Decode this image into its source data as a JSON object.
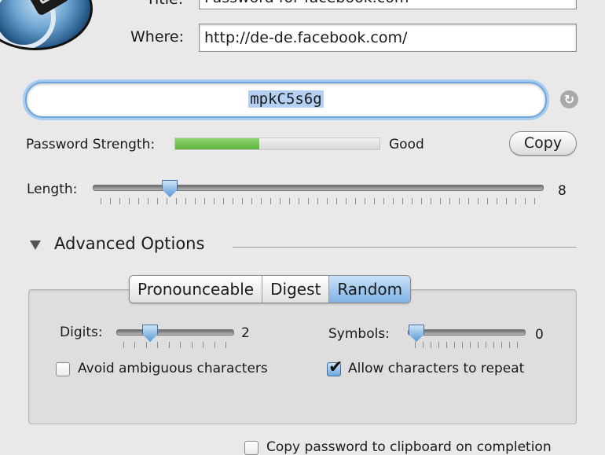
{
  "form": {
    "title_label": "Title:",
    "title_value": "Password for facebook.com",
    "where_label": "Where:",
    "where_value": "http://de-de.facebook.com/"
  },
  "password": {
    "value": "mpkC5s6g",
    "strength_label": "Password Strength:",
    "strength_text": "Good",
    "strength_fraction": 0.41,
    "copy_label": "Copy"
  },
  "length": {
    "label": "Length:",
    "value": "8",
    "fraction": 0.158,
    "ticks": 47
  },
  "advanced": {
    "heading": "Advanced Options",
    "tabs": [
      "Pronounceable",
      "Digest",
      "Random"
    ],
    "selected_tab": "Random",
    "digits": {
      "label": "Digits:",
      "value": "2",
      "fraction": 0.25,
      "ticks": 10
    },
    "symbols": {
      "label": "Symbols:",
      "value": "0",
      "fraction": 0.0,
      "ticks": 14
    },
    "avoid_ambiguous": {
      "label": "Avoid ambiguous characters",
      "checked": false
    },
    "allow_repeat": {
      "label": "Allow characters to repeat",
      "checked": true
    }
  },
  "copy_clipboard": {
    "label": "Copy password to clipboard on completion",
    "checked": false
  },
  "icons": [
    "keychain-logo-icon",
    "refresh-icon",
    "disclosure-triangle-icon",
    "checkmark-icon"
  ],
  "colors": {
    "accent": "#6ea6db",
    "strength_fill": "#6cbf45",
    "selection": "#b3d0f2"
  }
}
